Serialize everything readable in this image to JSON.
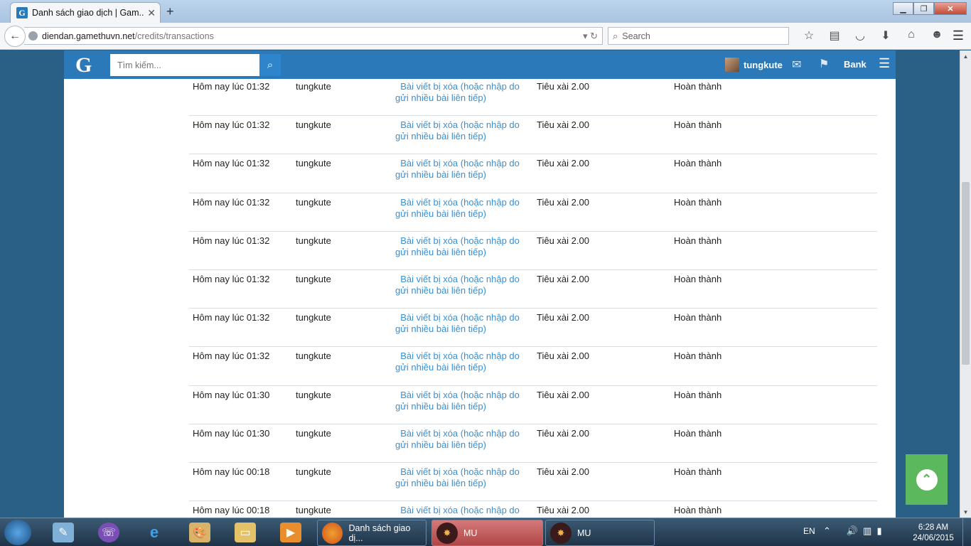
{
  "browser": {
    "tab_title": "Danh sách giao dịch | Gam...",
    "url_host": "diendan.gamethuvn.net",
    "url_path": "/credits/transactions",
    "search_placeholder": "Search"
  },
  "site": {
    "logo": "G",
    "search_placeholder": "Tìm kiếm...",
    "username": "tungkute",
    "bank_label": "Bank"
  },
  "transactions": [
    {
      "time": "Hôm nay lúc 01:32",
      "user": "tungkute",
      "reason": "Bài viết bị xóa (hoặc nhập do gửi nhiều bài liên tiếp)",
      "amount": "Tiêu xài 2.00",
      "status": "Hoàn thành"
    },
    {
      "time": "Hôm nay lúc 01:32",
      "user": "tungkute",
      "reason": "Bài viết bị xóa (hoặc nhập do gửi nhiều bài liên tiếp)",
      "amount": "Tiêu xài 2.00",
      "status": "Hoàn thành"
    },
    {
      "time": "Hôm nay lúc 01:32",
      "user": "tungkute",
      "reason": "Bài viết bị xóa (hoặc nhập do gửi nhiều bài liên tiếp)",
      "amount": "Tiêu xài 2.00",
      "status": "Hoàn thành"
    },
    {
      "time": "Hôm nay lúc 01:32",
      "user": "tungkute",
      "reason": "Bài viết bị xóa (hoặc nhập do gửi nhiều bài liên tiếp)",
      "amount": "Tiêu xài 2.00",
      "status": "Hoàn thành"
    },
    {
      "time": "Hôm nay lúc 01:32",
      "user": "tungkute",
      "reason": "Bài viết bị xóa (hoặc nhập do gửi nhiều bài liên tiếp)",
      "amount": "Tiêu xài 2.00",
      "status": "Hoàn thành"
    },
    {
      "time": "Hôm nay lúc 01:32",
      "user": "tungkute",
      "reason": "Bài viết bị xóa (hoặc nhập do gửi nhiều bài liên tiếp)",
      "amount": "Tiêu xài 2.00",
      "status": "Hoàn thành"
    },
    {
      "time": "Hôm nay lúc 01:32",
      "user": "tungkute",
      "reason": "Bài viết bị xóa (hoặc nhập do gửi nhiều bài liên tiếp)",
      "amount": "Tiêu xài 2.00",
      "status": "Hoàn thành"
    },
    {
      "time": "Hôm nay lúc 01:32",
      "user": "tungkute",
      "reason": "Bài viết bị xóa (hoặc nhập do gửi nhiều bài liên tiếp)",
      "amount": "Tiêu xài 2.00",
      "status": "Hoàn thành"
    },
    {
      "time": "Hôm nay lúc 01:30",
      "user": "tungkute",
      "reason": "Bài viết bị xóa (hoặc nhập do gửi nhiều bài liên tiếp)",
      "amount": "Tiêu xài 2.00",
      "status": "Hoàn thành"
    },
    {
      "time": "Hôm nay lúc 01:30",
      "user": "tungkute",
      "reason": "Bài viết bị xóa (hoặc nhập do gửi nhiều bài liên tiếp)",
      "amount": "Tiêu xài 2.00",
      "status": "Hoàn thành"
    },
    {
      "time": "Hôm nay lúc 00:18",
      "user": "tungkute",
      "reason": "Bài viết bị xóa (hoặc nhập do gửi nhiều bài liên tiếp)",
      "amount": "Tiêu xài 2.00",
      "status": "Hoàn thành"
    },
    {
      "time": "Hôm nay lúc 00:18",
      "user": "tungkute",
      "reason": "Bài viết bị xóa (hoặc nhập do gửi nhiều bài liên tiếp)",
      "amount": "Tiêu xài 2.00",
      "status": "Hoàn thành"
    }
  ],
  "taskbar": {
    "tasks": [
      {
        "label": "Danh sách giao dị...",
        "icon": "firefox-icon"
      },
      {
        "label": "MU",
        "icon": "mu-game-icon"
      },
      {
        "label": "MU",
        "icon": "mu-game-icon"
      }
    ],
    "language": "EN",
    "time": "6:28 AM",
    "date": "24/06/2015"
  },
  "colors": {
    "site_header": "#2b79b8",
    "link": "#3a8fd1",
    "back_to_top": "#5cb85c",
    "background": "#2a5f86"
  }
}
